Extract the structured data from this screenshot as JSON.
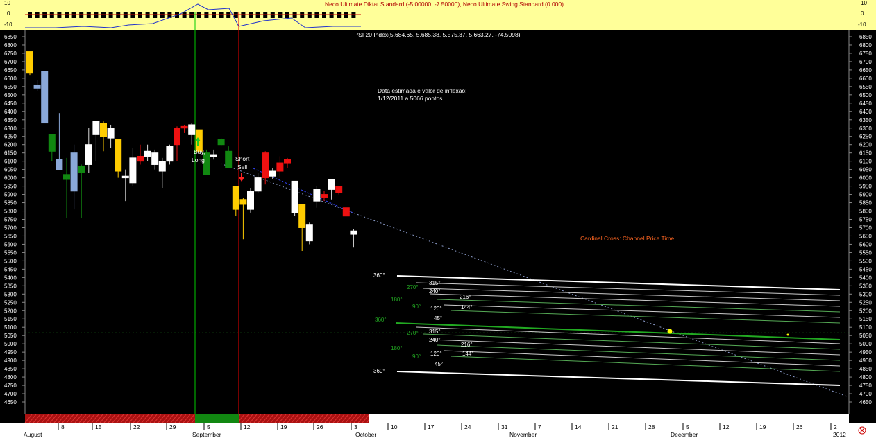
{
  "indicator_panel": {
    "title": "Neco Ultimate Diktat Standard (-5.00000, -7.50000), Neco Ultimate Swing Standard (0.000)",
    "ticks": [
      "10",
      "0",
      "-10"
    ]
  },
  "chart_data": {
    "type": "candlestick",
    "title": "PSI 20 Index(5,684.65, 5,685.38, 5,575.37, 5,663.27, -74.5098)",
    "ylim": [
      4600,
      6900
    ],
    "yticks": [
      6850,
      6800,
      6750,
      6700,
      6650,
      6600,
      6550,
      6500,
      6450,
      6400,
      6350,
      6300,
      6250,
      6200,
      6150,
      6100,
      6050,
      6000,
      5950,
      5900,
      5850,
      5800,
      5750,
      5700,
      5650,
      5600,
      5550,
      5500,
      5450,
      5400,
      5350,
      5300,
      5250,
      5200,
      5150,
      5100,
      5050,
      5000,
      4950,
      4900,
      4850,
      4800,
      4750,
      4700,
      4650
    ],
    "x_day_labels": [
      "8",
      "15",
      "22",
      "29",
      "5",
      "12",
      "19",
      "26",
      "3",
      "10",
      "17",
      "24",
      "31",
      "7",
      "14",
      "21",
      "28",
      "5",
      "12",
      "19",
      "26",
      "2"
    ],
    "x_month_labels": [
      "August",
      "September",
      "October",
      "November",
      "December",
      "2012"
    ],
    "candles": [
      {
        "o": 6760,
        "h": 6760,
        "l": 6620,
        "c": 6630,
        "col": "yellow"
      },
      {
        "o": 6560,
        "h": 6590,
        "l": 6520,
        "c": 6540,
        "col": "blue"
      },
      {
        "o": 6640,
        "h": 6640,
        "l": 6330,
        "c": 6330,
        "col": "blue"
      },
      {
        "o": 6160,
        "h": 6260,
        "l": 6100,
        "c": 6260,
        "col": "green"
      },
      {
        "o": 6110,
        "h": 6390,
        "l": 6050,
        "c": 6050,
        "col": "blue"
      },
      {
        "o": 6020,
        "h": 6120,
        "l": 5760,
        "c": 5990,
        "col": "green"
      },
      {
        "o": 6150,
        "h": 6200,
        "l": 5810,
        "c": 5920,
        "col": "blue"
      },
      {
        "o": 6030,
        "h": 6080,
        "l": 5760,
        "c": 6070,
        "col": "green"
      },
      {
        "o": 6080,
        "h": 6300,
        "l": 6030,
        "c": 6200,
        "col": "white"
      },
      {
        "o": 6260,
        "h": 6340,
        "l": 6100,
        "c": 6340,
        "col": "white"
      },
      {
        "o": 6330,
        "h": 6340,
        "l": 6160,
        "c": 6250,
        "col": "yellow"
      },
      {
        "o": 6240,
        "h": 6320,
        "l": 6180,
        "c": 6300,
        "col": "white"
      },
      {
        "o": 6230,
        "h": 6230,
        "l": 6000,
        "c": 6040,
        "col": "yellow"
      },
      {
        "o": 6010,
        "h": 6050,
        "l": 5860,
        "c": 6000,
        "col": "white"
      },
      {
        "o": 5970,
        "h": 6180,
        "l": 5950,
        "c": 6120,
        "col": "white"
      },
      {
        "o": 6130,
        "h": 6200,
        "l": 6080,
        "c": 6100,
        "col": "red"
      },
      {
        "o": 6130,
        "h": 6200,
        "l": 6100,
        "c": 6160,
        "col": "white"
      },
      {
        "o": 6150,
        "h": 6170,
        "l": 6050,
        "c": 6080,
        "col": "white"
      },
      {
        "o": 6040,
        "h": 6120,
        "l": 5940,
        "c": 6100,
        "col": "white"
      },
      {
        "o": 6100,
        "h": 6200,
        "l": 6080,
        "c": 6190,
        "col": "white"
      },
      {
        "o": 6200,
        "h": 6310,
        "l": 6100,
        "c": 6300,
        "col": "red"
      },
      {
        "o": 6300,
        "h": 6320,
        "l": 6270,
        "c": 6310,
        "col": "red"
      },
      {
        "o": 6260,
        "h": 6330,
        "l": 6200,
        "c": 6320,
        "col": "white"
      },
      {
        "o": 6290,
        "h": 6290,
        "l": 6150,
        "c": 6160,
        "col": "yellow"
      },
      {
        "o": 6150,
        "h": 6170,
        "l": 6020,
        "c": 6020,
        "col": "green"
      },
      {
        "o": 6140,
        "h": 6170,
        "l": 6110,
        "c": 6130,
        "col": "white"
      },
      {
        "o": 6200,
        "h": 6240,
        "l": 6190,
        "c": 6230,
        "col": "green"
      },
      {
        "o": 6160,
        "h": 6190,
        "l": 6060,
        "c": 6060,
        "col": "green"
      },
      {
        "o": 5950,
        "h": 5950,
        "l": 5770,
        "c": 5810,
        "col": "yellow"
      },
      {
        "o": 5870,
        "h": 5880,
        "l": 5630,
        "c": 5840,
        "col": "yellow"
      },
      {
        "o": 5810,
        "h": 5940,
        "l": 5790,
        "c": 5920,
        "col": "white"
      },
      {
        "o": 5920,
        "h": 6030,
        "l": 5910,
        "c": 6000,
        "col": "white"
      },
      {
        "o": 6000,
        "h": 6160,
        "l": 5960,
        "c": 6150,
        "col": "red"
      },
      {
        "o": 6040,
        "h": 6060,
        "l": 5990,
        "c": 6010,
        "col": "white"
      },
      {
        "o": 6040,
        "h": 6130,
        "l": 6000,
        "c": 6090,
        "col": "red"
      },
      {
        "o": 6090,
        "h": 6120,
        "l": 6060,
        "c": 6110,
        "col": "red"
      },
      {
        "o": 5980,
        "h": 5980,
        "l": 5770,
        "c": 5790,
        "col": "white"
      },
      {
        "o": 5840,
        "h": 5840,
        "l": 5560,
        "c": 5700,
        "col": "yellow"
      },
      {
        "o": 5620,
        "h": 5730,
        "l": 5600,
        "c": 5720,
        "col": "white"
      },
      {
        "o": 5860,
        "h": 5950,
        "l": 5820,
        "c": 5930,
        "col": "white"
      },
      {
        "o": 5880,
        "h": 5920,
        "l": 5860,
        "c": 5900,
        "col": "red"
      },
      {
        "o": 5930,
        "h": 5980,
        "l": 5870,
        "c": 5990,
        "col": "white"
      },
      {
        "o": 5950,
        "h": 5950,
        "l": 5900,
        "c": 5910,
        "col": "red"
      },
      {
        "o": 5820,
        "h": 5820,
        "l": 5770,
        "c": 5770,
        "col": "red"
      },
      {
        "o": 5680,
        "h": 5690,
        "l": 5580,
        "c": 5660,
        "col": "white"
      }
    ],
    "annotations": {
      "buy_label": "Buy Long",
      "sell_label": "Short Sell",
      "inflexion_note": "Data estimada e valor de inflexão: 1/12/2011 a 5066 pontos.",
      "cross_label": "Cardinal Cross: Channel Price Time",
      "horizontal_level": 5066
    },
    "angle_labels_upper": [
      "360°",
      "270°",
      "315°",
      "240°",
      "180°",
      "216°",
      "90°",
      "120°",
      "144°",
      "45°"
    ],
    "angle_labels_lower": [
      "360°",
      "270°",
      "315°",
      "240°",
      "180°",
      "216°",
      "90°",
      "120°",
      "144°",
      "45°",
      "360°"
    ]
  },
  "footer": {
    "corner_icon": "settings-icon"
  },
  "colors": {
    "indicator_bg": "#ffff99",
    "up_white": "#ffffff",
    "down_yellow": "#ffcc00",
    "blue": "#8aa8d8",
    "green": "#118811",
    "red": "#ee1111",
    "buy_line": "#00cc00",
    "sell_line": "#ee0000"
  }
}
